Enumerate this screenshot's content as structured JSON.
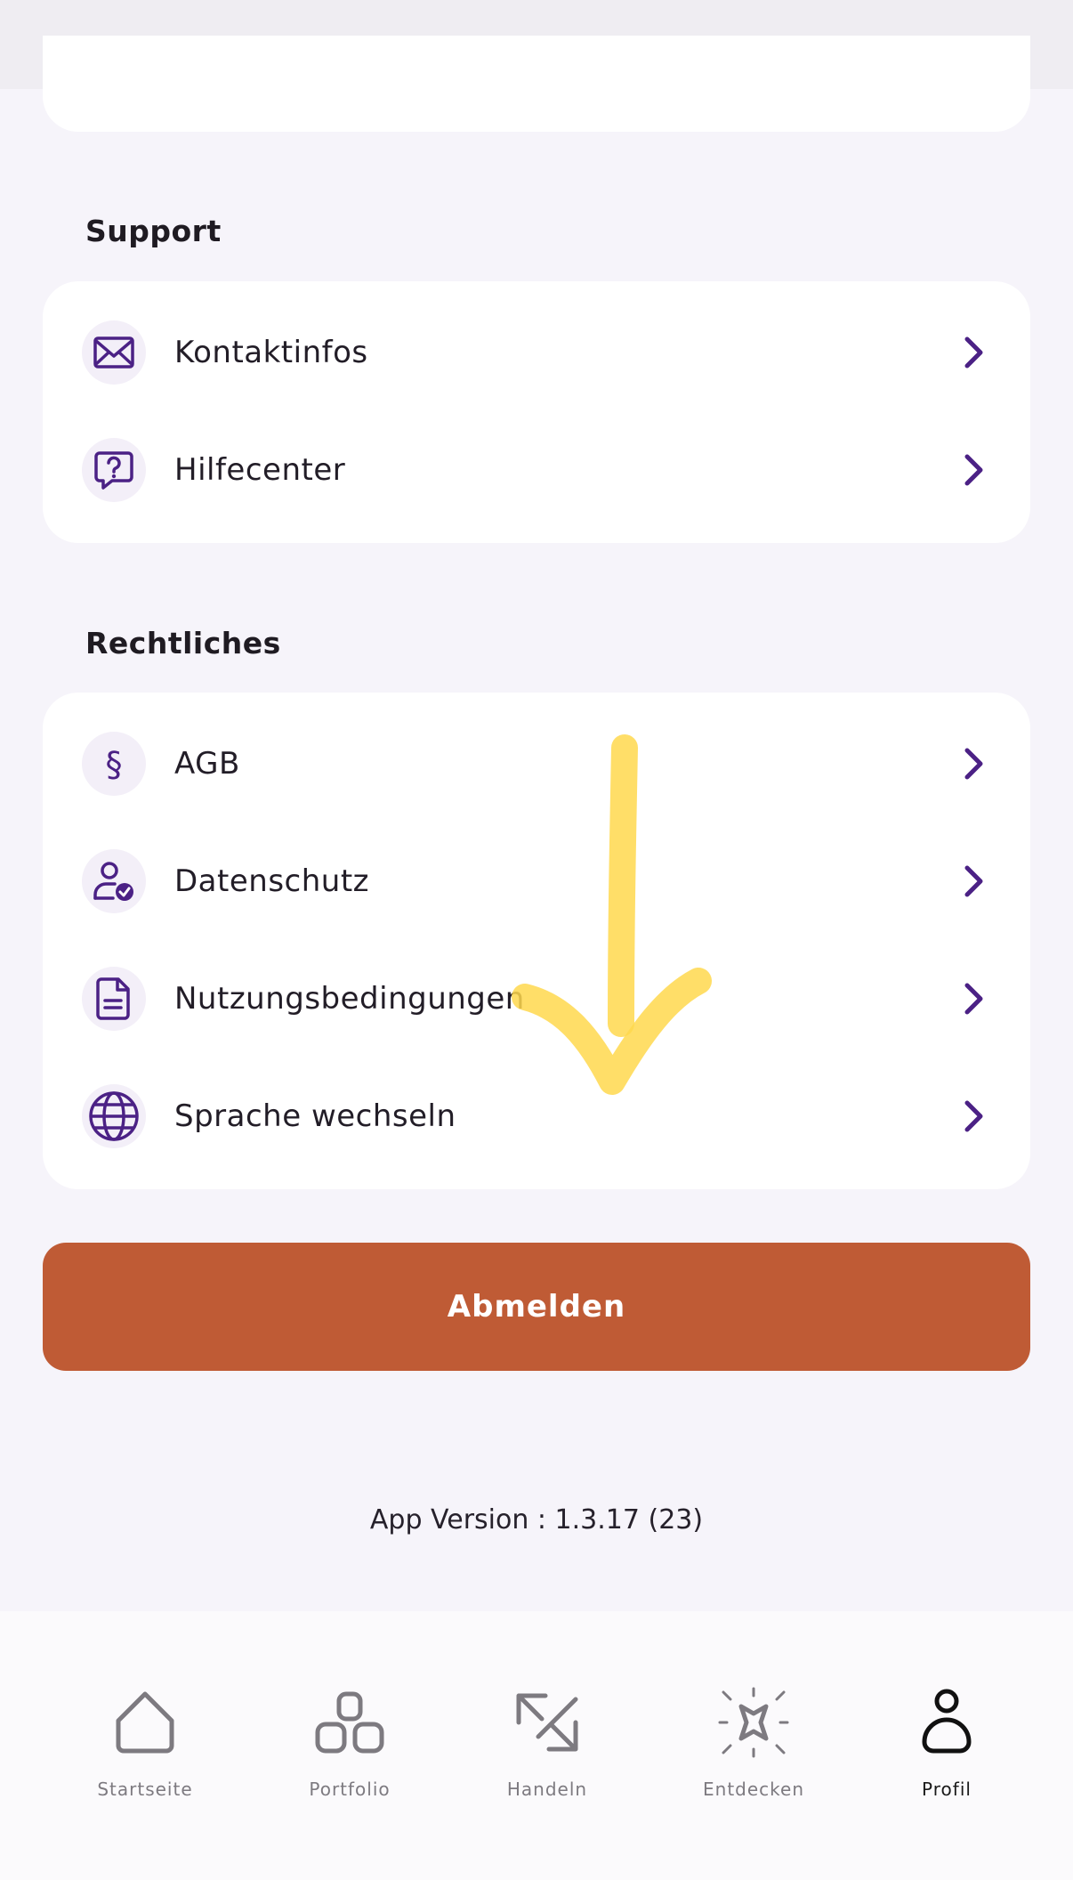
{
  "sections": {
    "support": {
      "title": "Support",
      "items": [
        {
          "label": "Kontaktinfos",
          "icon": "mail-icon"
        },
        {
          "label": "Hilfecenter",
          "icon": "help-chat-icon"
        }
      ]
    },
    "legal": {
      "title": "Rechtliches",
      "items": [
        {
          "label": "AGB",
          "icon": "paragraph-icon"
        },
        {
          "label": "Datenschutz",
          "icon": "user-shield-icon"
        },
        {
          "label": "Nutzungsbedingungen",
          "icon": "document-icon"
        },
        {
          "label": "Sprache wechseln",
          "icon": "globe-icon"
        }
      ]
    }
  },
  "logout_label": "Abmelden",
  "version_text": "App Version : 1.3.17 (23)",
  "tabbar": {
    "tabs": [
      {
        "label": "Startseite",
        "icon": "home-icon",
        "active": false
      },
      {
        "label": "Portfolio",
        "icon": "portfolio-icon",
        "active": false
      },
      {
        "label": "Handeln",
        "icon": "trade-arrows-icon",
        "active": false
      },
      {
        "label": "Entdecken",
        "icon": "discover-star-icon",
        "active": false
      },
      {
        "label": "Profil",
        "icon": "profile-icon",
        "active": true
      }
    ]
  },
  "colors": {
    "accent": "#4b2185",
    "logout": "#bf5b35",
    "background": "#f6f4fa",
    "annotation": "#ffd84d"
  }
}
